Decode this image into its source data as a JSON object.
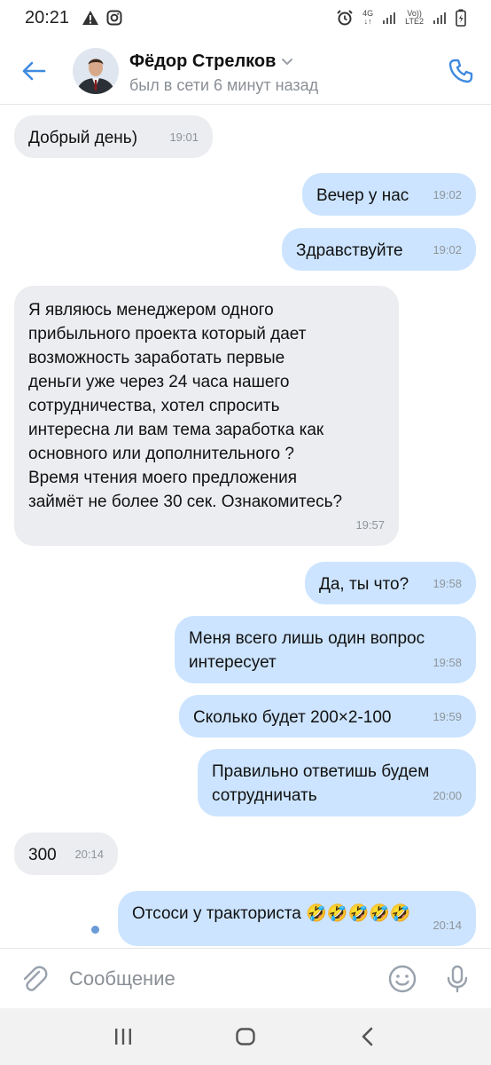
{
  "status_bar": {
    "time": "20:21",
    "left_icons": [
      "warning-icon",
      "instagram-icon"
    ],
    "net_4g": "4G",
    "volte": "Vo))",
    "lte2": "LTE2"
  },
  "header": {
    "name": "Фёдор Стрелков",
    "presence": "был в сети 6 минут назад",
    "back_icon": "arrow-left-icon",
    "call_icon": "phone-icon",
    "accent_color": "#3f8ae0"
  },
  "messages": [
    {
      "direction": "in",
      "text": "Добрый день)",
      "time": "19:01"
    },
    {
      "direction": "out",
      "text": "Вечер у нас",
      "time": "19:02"
    },
    {
      "direction": "out",
      "text": "Здравствуйте",
      "time": "19:02"
    },
    {
      "direction": "in",
      "text": "Я являюсь менеджером одного\nприбыльного проекта который дает\nвозможность заработать первые\nденьги уже через 24 часа нашего\nсотрудничества, хотел спросить\nинтересна ли вам тема заработка как\nосновного или дополнительного ?\nВремя чтения моего предложения\nзаймёт не более 30 сек. Ознакомитесь?",
      "time": "19:57"
    },
    {
      "direction": "out",
      "text": "Да, ты что?",
      "time": "19:58"
    },
    {
      "direction": "out",
      "text": "Меня всего лишь один вопрос\nинтересует",
      "time": "19:58"
    },
    {
      "direction": "out",
      "text": "Сколько будет 200×2-100",
      "time": "19:59"
    },
    {
      "direction": "out",
      "text": "Правильно ответишь будем\nсотрудничать",
      "time": "20:00"
    },
    {
      "direction": "in",
      "text": "300",
      "time": "20:14"
    },
    {
      "direction": "out",
      "text": "Отсоси у тракториста 🤣🤣🤣🤣🤣",
      "time": "20:14",
      "unread": true
    }
  ],
  "composer": {
    "placeholder": "Сообщение",
    "attach_icon": "paperclip-icon",
    "emoji_icon": "smiley-icon",
    "mic_icon": "microphone-icon"
  },
  "nav_bar": {
    "icons": [
      "recent-apps-icon",
      "home-icon",
      "back-icon"
    ]
  },
  "colors": {
    "incoming_bubble": "#ebedf0",
    "outgoing_bubble": "#cce4ff",
    "accent": "#3f8ae0"
  }
}
